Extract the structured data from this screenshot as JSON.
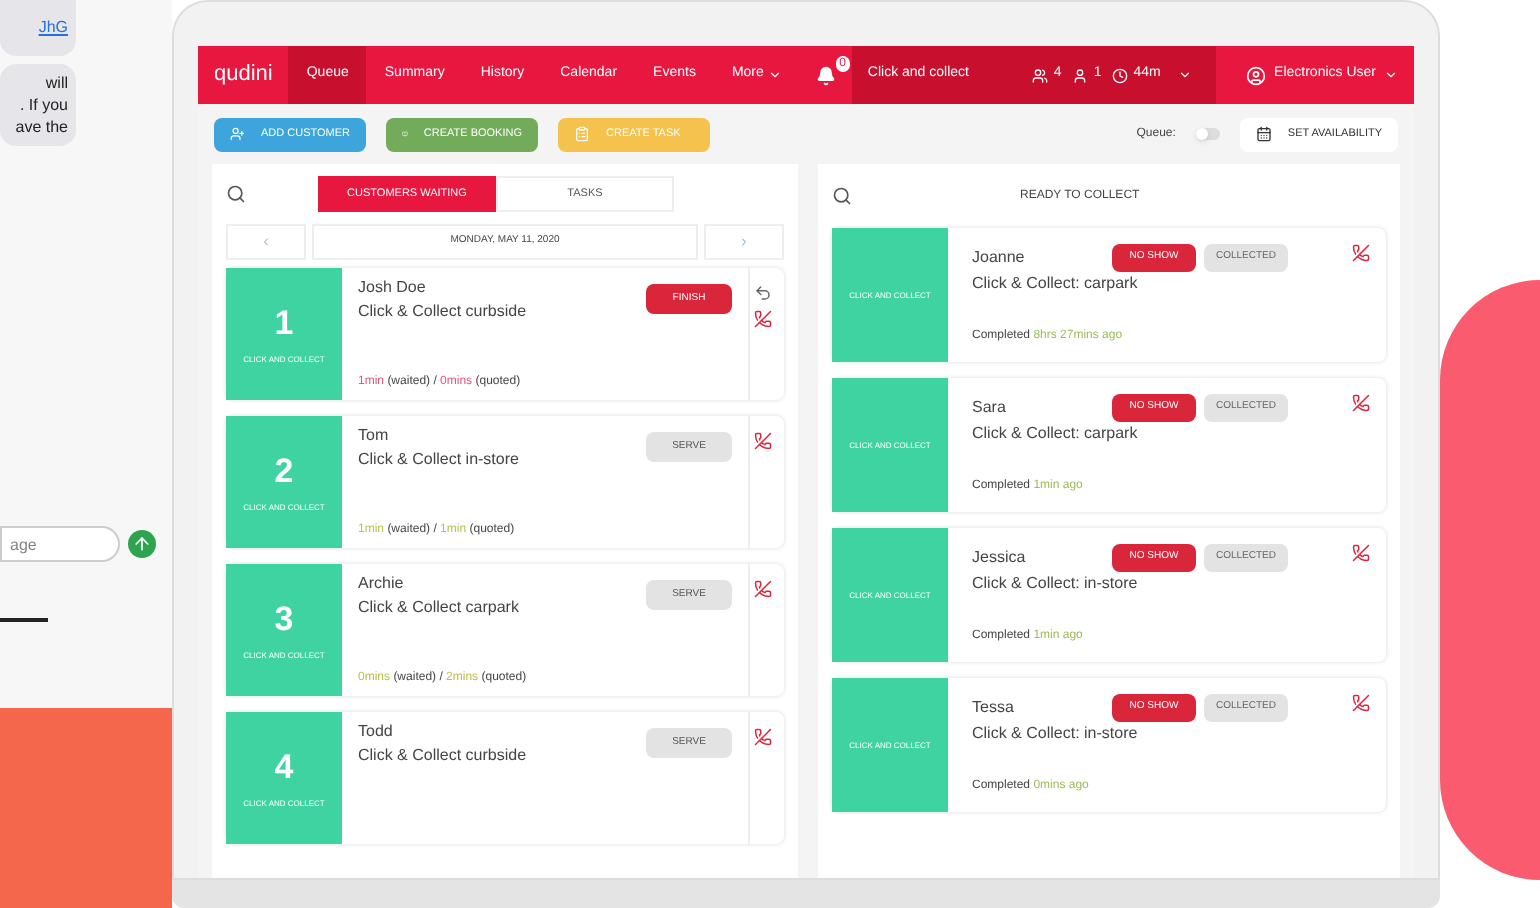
{
  "chat": {
    "link": "JhG",
    "message": "will\n. If you\nave the",
    "input": {
      "placeholder": "age"
    }
  },
  "nav": {
    "logo": "qudini",
    "items": [
      {
        "label": "Queue",
        "selected": true
      },
      {
        "label": "Summary",
        "selected": false
      },
      {
        "label": "History",
        "selected": false
      },
      {
        "label": "Calendar",
        "selected": false
      },
      {
        "label": "Events",
        "selected": false
      },
      {
        "label": "More",
        "selected": false
      }
    ],
    "notification_count": "0",
    "location": "Click and collect",
    "stats": [
      {
        "kind": "group",
        "value": "4"
      },
      {
        "kind": "person",
        "value": "1"
      },
      {
        "kind": "clock",
        "value": "44m"
      }
    ],
    "user": "Electronics User"
  },
  "toolbar": {
    "buttons": [
      {
        "kind": "add",
        "label": "ADD CUSTOMER"
      },
      {
        "kind": "booking",
        "label": "CREATE BOOKING"
      },
      {
        "kind": "task",
        "label": "CREATE TASK"
      }
    ],
    "queue_label": "Queue:",
    "queue_toggle": {
      "on": false
    },
    "availability_button": "SET AVAILABILITY"
  },
  "waiting": {
    "tabs": [
      {
        "label": "CUSTOMERS WAITING",
        "selected": true
      },
      {
        "label": "TASKS",
        "selected": false
      }
    ],
    "date": "MONDAY, MAY 11, 2020",
    "customers": [
      {
        "number": "1",
        "category": "CLICK AND COLLECT",
        "name": "Josh Doe",
        "service": "Click & Collect curbside",
        "action": {
          "kind": "finish",
          "label": "FINISH"
        },
        "undo": true,
        "wait": {
          "waited": "1min",
          "waited_label": "(waited) /",
          "quoted": "0mins",
          "quoted_label": "(quoted)",
          "color": "#e0567a"
        }
      },
      {
        "number": "2",
        "category": "CLICK AND COLLECT",
        "name": "Tom",
        "service": "Click & Collect in-store",
        "action": {
          "kind": "serve",
          "label": "SERVE"
        },
        "undo": false,
        "wait": {
          "waited": "1min",
          "waited_label": "(waited) /",
          "quoted": "1min",
          "quoted_label": "(quoted)",
          "color": "#b9c24a"
        }
      },
      {
        "number": "3",
        "category": "CLICK AND COLLECT",
        "name": "Archie",
        "service": "Click & Collect carpark",
        "action": {
          "kind": "serve",
          "label": "SERVE"
        },
        "undo": false,
        "wait": {
          "waited": "0mins",
          "waited_label": "(waited) /",
          "quoted": "2mins",
          "quoted_label": "(quoted)",
          "color": "#b9c24a"
        }
      },
      {
        "number": "4",
        "category": "CLICK AND COLLECT",
        "name": "Todd",
        "service": "Click & Collect curbside",
        "action": {
          "kind": "serve",
          "label": "SERVE"
        },
        "undo": false
      }
    ]
  },
  "ready": {
    "title": "READY TO COLLECT",
    "customers": [
      {
        "category": "CLICK AND COLLECT",
        "name": "Joanne",
        "service": "Click & Collect: carpark",
        "no_show": "NO SHOW",
        "collected": "COLLECTED",
        "completed_label": "Completed",
        "completed_ago": "8hrs 27mins ago"
      },
      {
        "category": "CLICK AND COLLECT",
        "name": "Sara",
        "service": "Click & Collect: carpark",
        "no_show": "NO SHOW",
        "collected": "COLLECTED",
        "completed_label": "Completed",
        "completed_ago": "1min ago"
      },
      {
        "category": "CLICK AND COLLECT",
        "name": "Jessica",
        "service": "Click & Collect: in-store",
        "no_show": "NO SHOW",
        "collected": "COLLECTED",
        "completed_label": "Completed",
        "completed_ago": "1min ago"
      },
      {
        "category": "CLICK AND COLLECT",
        "name": "Tessa",
        "service": "Click & Collect: in-store",
        "no_show": "NO SHOW",
        "collected": "COLLECTED",
        "completed_label": "Completed",
        "completed_ago": "0mins ago"
      }
    ]
  }
}
